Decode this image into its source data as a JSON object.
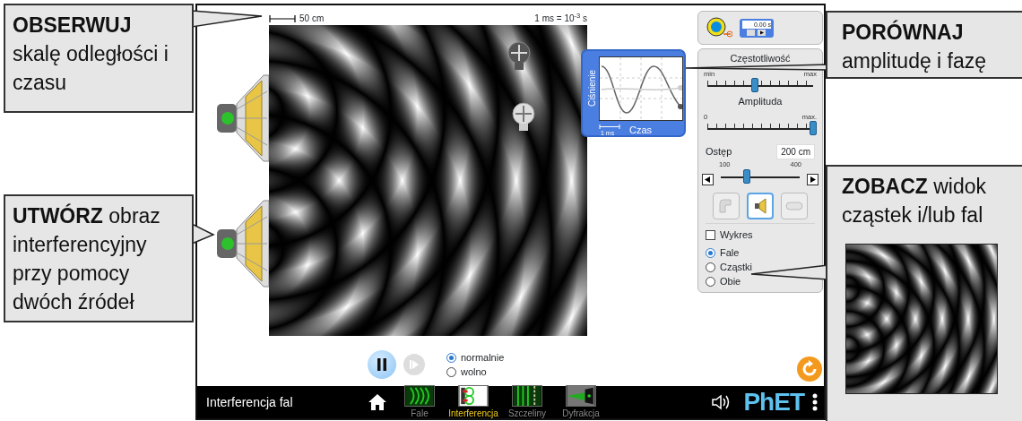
{
  "callouts": [
    {
      "text": "**OBSERWUJ** skalę odległości i czasu"
    },
    {
      "text": "**UTWÓRZ** obraz interferencyjny przy pomocy dwóch źródeł"
    },
    {
      "text": "**PORÓWNAJ** amplitudę i fazę"
    },
    {
      "text": "**ZOBACZ** widok cząstek i/lub fal"
    }
  ],
  "scale": {
    "distance": "50 cm",
    "time": "1 ms = 10$^{-3}$ s"
  },
  "stopwatch": {
    "reading": "0.00 s"
  },
  "graph": {
    "y_label": "Ciśnienie",
    "x_label": "Czas",
    "scale": "1 ms"
  },
  "controls": {
    "frequency": {
      "label": "Częstotliwość",
      "min": "min",
      "max": "max",
      "level": 0.45
    },
    "amplitude": {
      "label": "Amplituda",
      "min": "0",
      "max": "max.",
      "level": 1.0
    },
    "separation": {
      "label": "Ostęp",
      "value": "200 cm",
      "min": "100",
      "max": "400",
      "level": 0.33
    },
    "sources": [
      {
        "kind": "water",
        "selected": false
      },
      {
        "kind": "sound",
        "selected": true
      },
      {
        "kind": "light",
        "selected": false
      }
    ],
    "graph_checkbox": {
      "label": "Wykres",
      "checked": false
    },
    "views": [
      {
        "label": "Fale",
        "selected": true
      },
      {
        "label": "Cząstki",
        "selected": false
      },
      {
        "label": "Obie",
        "selected": false
      }
    ]
  },
  "playback": {
    "playing": true,
    "speeds": [
      {
        "label": "normalnie",
        "selected": true
      },
      {
        "label": "wolno",
        "selected": false
      }
    ]
  },
  "navbar": {
    "title": "Interferencja fal",
    "logo": "PhET",
    "screens": [
      {
        "label": "Fale",
        "selected": false
      },
      {
        "label": "Interferencja",
        "selected": true
      },
      {
        "label": "Szczeliny",
        "selected": false
      },
      {
        "label": "Dyfrakcja",
        "selected": false
      }
    ]
  }
}
